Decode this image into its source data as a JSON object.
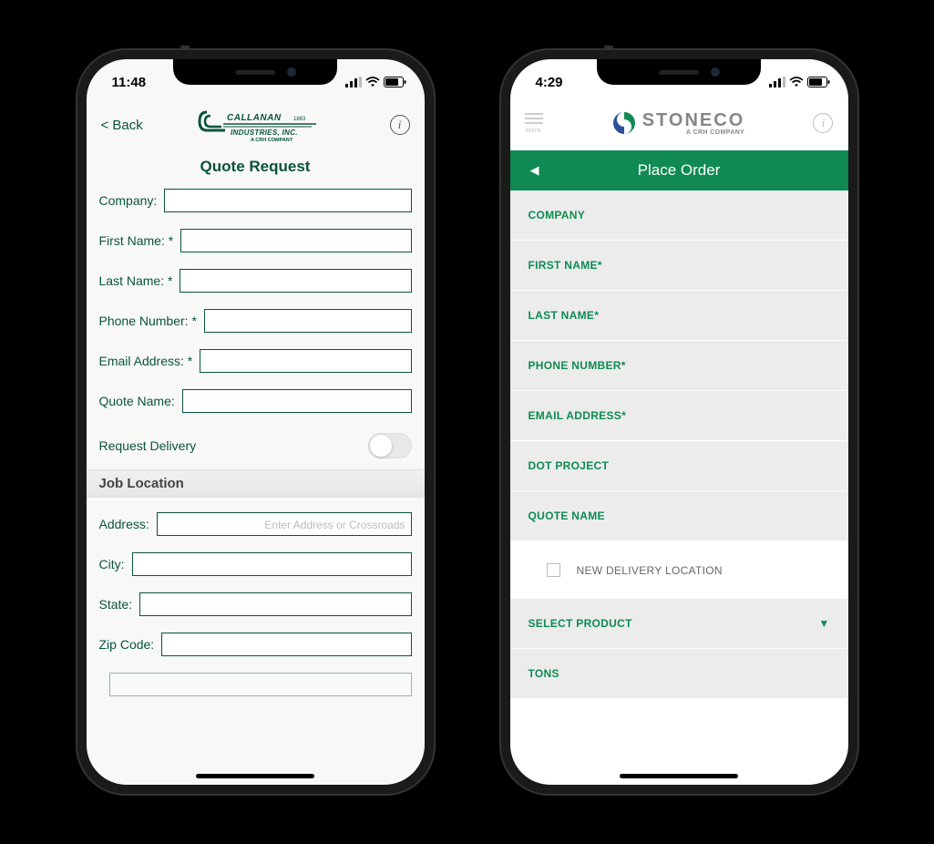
{
  "phone1": {
    "status": {
      "time": "11:48"
    },
    "header": {
      "back_label": "< Back",
      "logo_name": "CALLANAN",
      "logo_year": "1883",
      "logo_line2": "INDUSTRIES, INC.",
      "logo_sub": "A CRH COMPANY"
    },
    "title": "Quote Request",
    "fields": {
      "company": "Company:",
      "first_name": "First Name: *",
      "last_name": "Last Name: *",
      "phone": "Phone Number: *",
      "email": "Email Address: *",
      "quote_name": "Quote Name:",
      "delivery_toggle": "Request Delivery",
      "section_job": "Job Location",
      "address": "Address:",
      "address_placeholder": "Enter Address or Crossroads",
      "city": "City:",
      "state": "State:",
      "zip": "Zip Code:"
    }
  },
  "phone2": {
    "status": {
      "time": "4:29"
    },
    "header": {
      "menu_label": "MAIN",
      "logo_name": "STONECO",
      "logo_sub": "A CRH COMPANY"
    },
    "titlebar": {
      "title": "Place Order"
    },
    "fields": {
      "company": "COMPANY",
      "first_name": "FIRST NAME*",
      "last_name": "LAST NAME*",
      "phone": "PHONE NUMBER*",
      "email": "EMAIL ADDRESS*",
      "dot_project": "DOT PROJECT",
      "quote_name": "QUOTE NAME",
      "new_delivery": "NEW DELIVERY LOCATION",
      "select_product": "SELECT PRODUCT",
      "tons": "TONS"
    }
  }
}
